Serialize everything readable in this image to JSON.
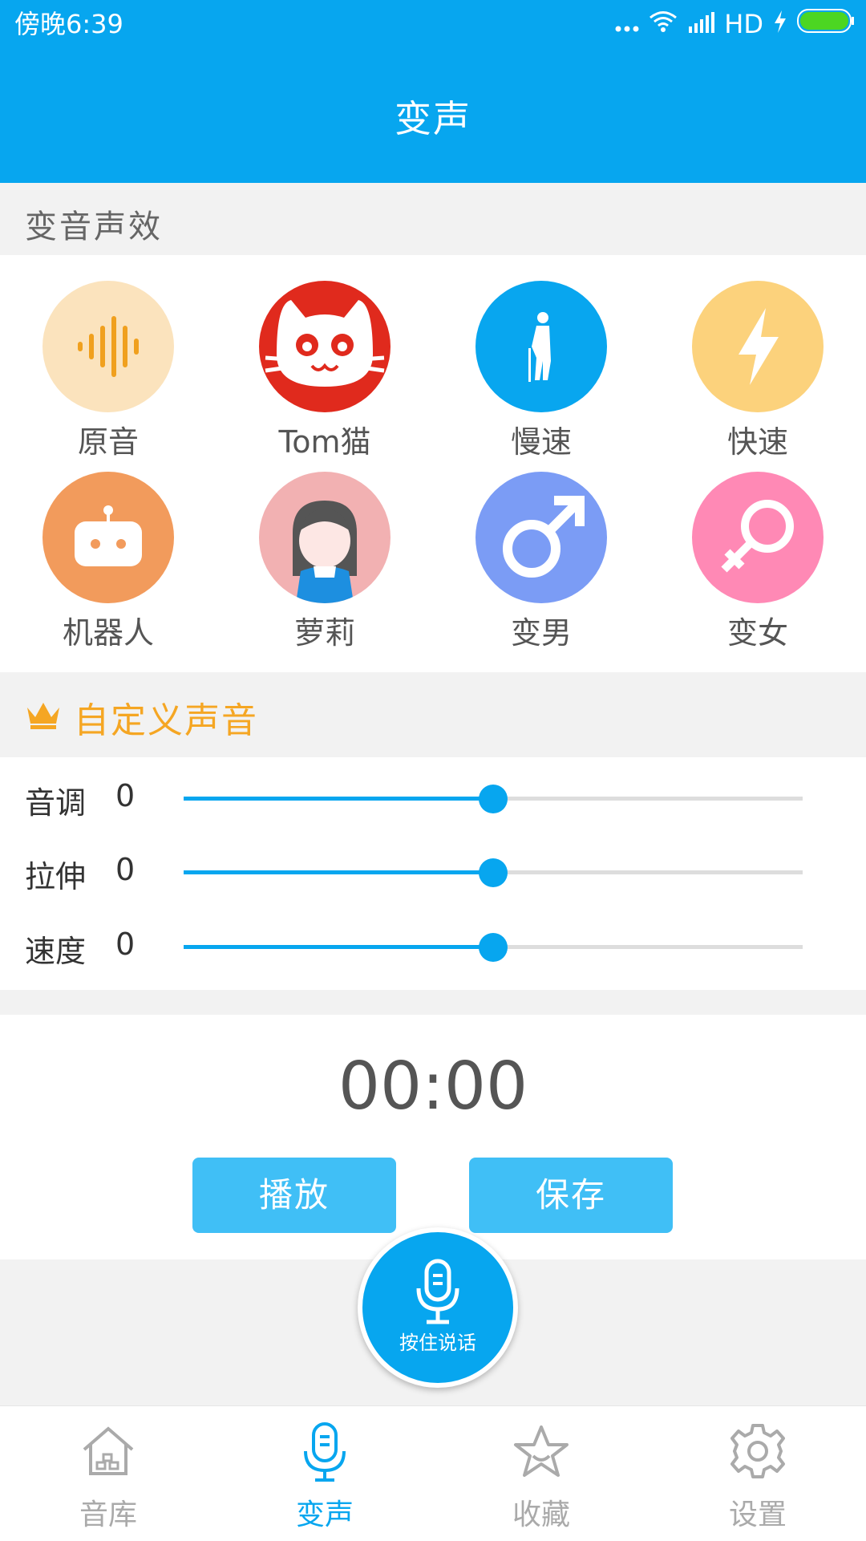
{
  "status_bar": {
    "time": "傍晚6:39",
    "network": "HD"
  },
  "header": {
    "title": "变声"
  },
  "effects_section": {
    "title": "变音声效",
    "items": [
      {
        "label": "原音",
        "icon": "waveform-icon",
        "color": "#fbe3bd"
      },
      {
        "label": "Tom猫",
        "icon": "tom-cat-icon",
        "color": "#e02a1d"
      },
      {
        "label": "慢速",
        "icon": "elderly-man-icon",
        "color": "#08a6ef"
      },
      {
        "label": "快速",
        "icon": "lightning-icon",
        "color": "#fcd27c"
      },
      {
        "label": "机器人",
        "icon": "robot-icon",
        "color": "#f29b5c"
      },
      {
        "label": "萝莉",
        "icon": "girl-icon",
        "color": "#f2b1b2"
      },
      {
        "label": "变男",
        "icon": "male-symbol-icon",
        "color": "#7b9cf5"
      },
      {
        "label": "变女",
        "icon": "female-symbol-icon",
        "color": "#ff89b5"
      }
    ]
  },
  "custom_section": {
    "title": "自定义声音",
    "sliders": [
      {
        "label": "音调",
        "value": "0",
        "level": 0.5
      },
      {
        "label": "拉伸",
        "value": "0",
        "level": 0.5
      },
      {
        "label": "速度",
        "value": "0",
        "level": 0.5
      }
    ]
  },
  "recorder": {
    "timer": "00:00",
    "play_label": "播放",
    "save_label": "保存",
    "hold_label": "按住说话"
  },
  "tabs": [
    {
      "label": "音库",
      "icon": "home-icon",
      "active": false
    },
    {
      "label": "变声",
      "icon": "microphone-icon",
      "active": true
    },
    {
      "label": "收藏",
      "icon": "star-icon",
      "active": false
    },
    {
      "label": "设置",
      "icon": "gear-icon",
      "active": false
    }
  ],
  "colors": {
    "primary": "#07a6ef",
    "accent": "#f5a623",
    "button": "#40bff6"
  }
}
